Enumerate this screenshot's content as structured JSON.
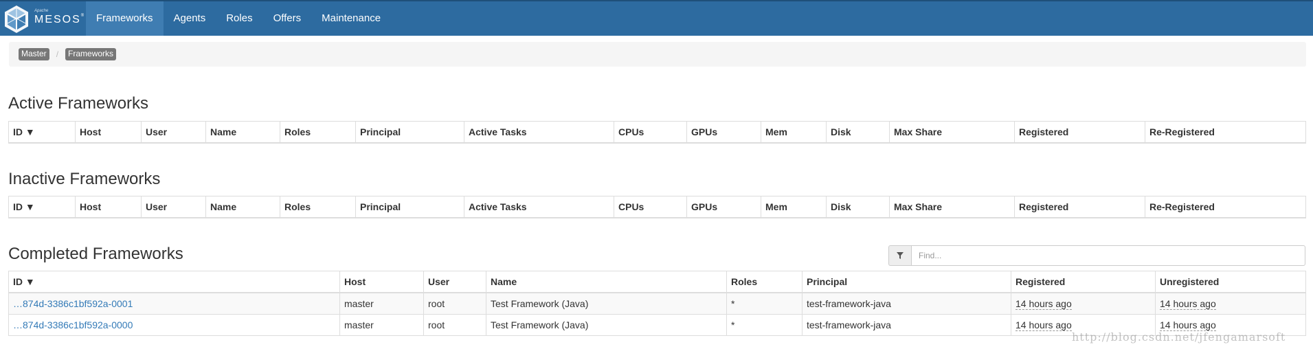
{
  "brand": {
    "apache": "Apache",
    "name": "MESOS",
    "tm": "®"
  },
  "nav": {
    "items": [
      {
        "label": "Frameworks",
        "active": true
      },
      {
        "label": "Agents"
      },
      {
        "label": "Roles"
      },
      {
        "label": "Offers"
      },
      {
        "label": "Maintenance"
      }
    ]
  },
  "breadcrumb": {
    "items": [
      "Master",
      "Frameworks"
    ],
    "separator": "/"
  },
  "active": {
    "title": "Active Frameworks",
    "columns": [
      "ID ▼",
      "Host",
      "User",
      "Name",
      "Roles",
      "Principal",
      "Active Tasks",
      "CPUs",
      "GPUs",
      "Mem",
      "Disk",
      "Max Share",
      "Registered",
      "Re-Registered"
    ]
  },
  "inactive": {
    "title": "Inactive Frameworks",
    "columns": [
      "ID ▼",
      "Host",
      "User",
      "Name",
      "Roles",
      "Principal",
      "Active Tasks",
      "CPUs",
      "GPUs",
      "Mem",
      "Disk",
      "Max Share",
      "Registered",
      "Re-Registered"
    ]
  },
  "completed": {
    "title": "Completed Frameworks",
    "filter": {
      "placeholder": "Find..."
    },
    "columns": [
      "ID ▼",
      "Host",
      "User",
      "Name",
      "Roles",
      "Principal",
      "Registered",
      "Unregistered"
    ],
    "rows": [
      {
        "id": "…874d-3386c1bf592a-0001",
        "host": "master",
        "user": "root",
        "name": "Test Framework (Java)",
        "roles": "*",
        "principal": "test-framework-java",
        "registered": "14 hours ago",
        "unregistered": "14 hours ago"
      },
      {
        "id": "…874d-3386c1bf592a-0000",
        "host": "master",
        "user": "root",
        "name": "Test Framework (Java)",
        "roles": "*",
        "principal": "test-framework-java",
        "registered": "14 hours ago",
        "unregistered": "14 hours ago"
      }
    ]
  },
  "watermark": "http://blog.csdn.net/jfengamarsoft"
}
